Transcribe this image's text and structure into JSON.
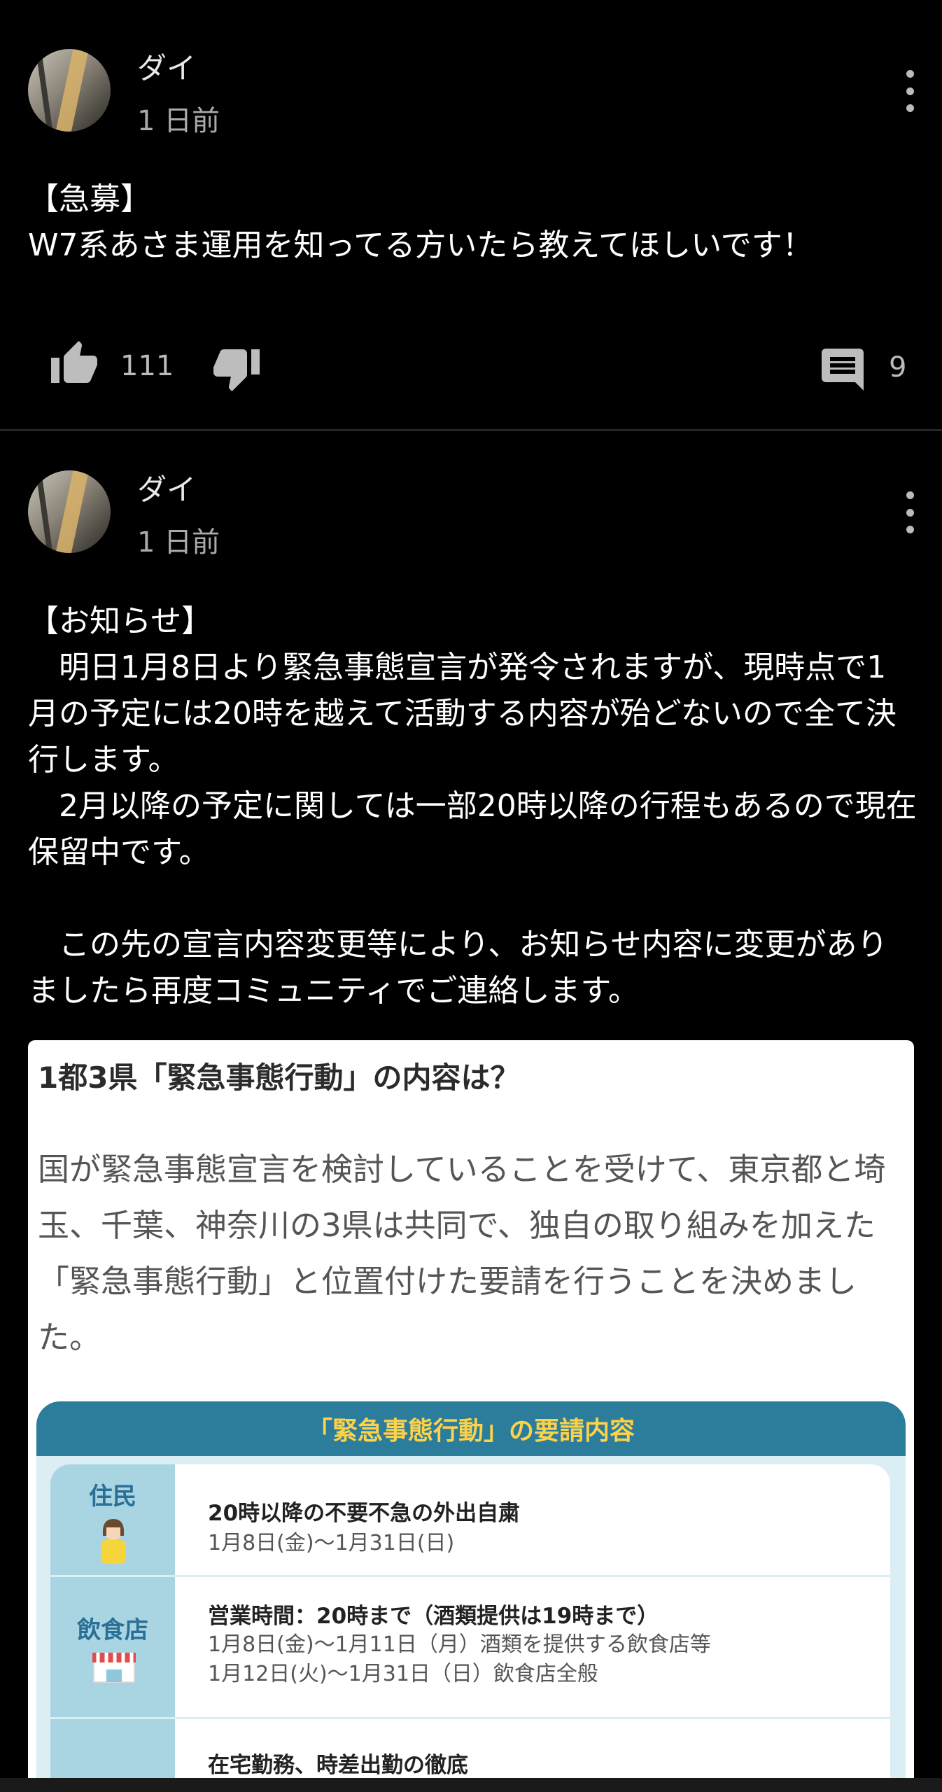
{
  "posts": [
    {
      "author": "ダイ",
      "time": "1 日前",
      "text": "【急募】\nW7系あさま運用を知ってる方いたら教えてほしいです！",
      "likes": "111",
      "comments": "9"
    },
    {
      "author": "ダイ",
      "time": "1 日前",
      "text": "【お知らせ】\n　明日1月8日より緊急事態宣言が発令されますが、現時点で1月の予定には20時を越えて活動する内容が殆どないので全て決行します。\n　2月以降の予定に関しては一部20時以降の行程もあるので現在保留中です。\n\n　この先の宣言内容変更等により、お知らせ内容に変更がありましたら再度コミュニティでご連絡します。"
    }
  ],
  "card": {
    "title": "1都3県「緊急事態行動」の内容は？",
    "description": "国が緊急事態宣言を検討していることを受けて、東京都と埼玉、千葉、神奈川の3県は共同で、独自の取り組みを加えた「緊急事態行動」と位置付けた要請を行うことを決めました。",
    "table_title": "「緊急事態行動」の要請内容",
    "rows": [
      {
        "label": "住民",
        "main": "20時以降の不要不急の外出自粛",
        "sub": "1月8日(金)～1月31日(日)"
      },
      {
        "label": "飲食店",
        "main": "営業時間：20時まで（酒類提供は19時まで）",
        "sub": "1月8日(金)～1月11日（月）酒類を提供する飲食店等\n1月12日(火)～1月31日（日）飲食店全般"
      },
      {
        "label": "",
        "main": "在宅勤務、時差出勤の徹底",
        "sub": ""
      }
    ]
  }
}
